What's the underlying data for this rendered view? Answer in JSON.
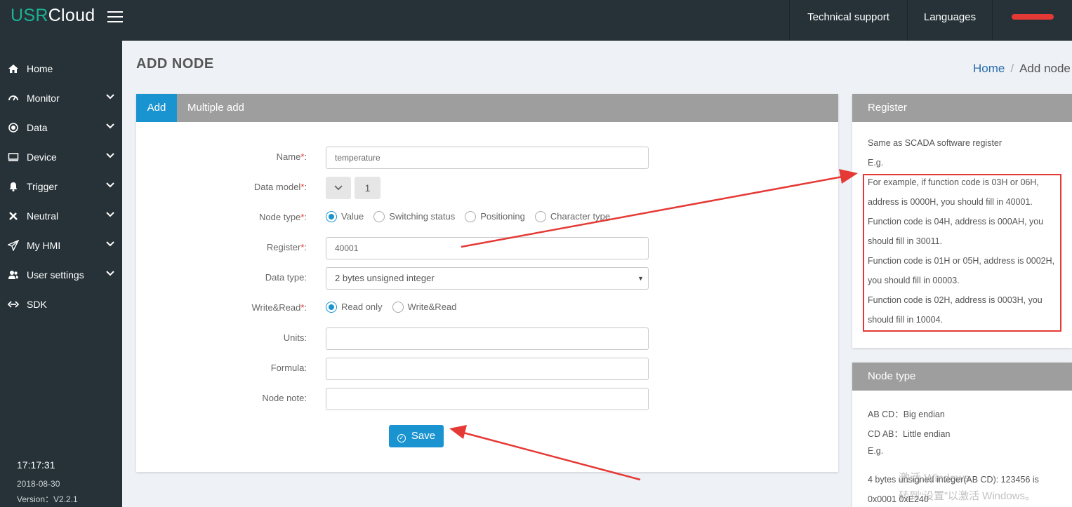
{
  "app": {
    "logo_usr": "USR",
    "logo_cloud": "Cloud"
  },
  "topbar": {
    "support": "Technical support",
    "languages": "Languages"
  },
  "sidebar": {
    "items": [
      {
        "label": "Home",
        "icon": "home-icon",
        "has_children": false
      },
      {
        "label": "Monitor",
        "icon": "gauge-icon",
        "has_children": true
      },
      {
        "label": "Data",
        "icon": "dot-circle-icon",
        "has_children": true
      },
      {
        "label": "Device",
        "icon": "monitor-icon",
        "has_children": true
      },
      {
        "label": "Trigger",
        "icon": "bell-icon",
        "has_children": true
      },
      {
        "label": "Neutral",
        "icon": "tools-icon",
        "has_children": true
      },
      {
        "label": "My HMI",
        "icon": "send-icon",
        "has_children": true
      },
      {
        "label": "User settings",
        "icon": "users-icon",
        "has_children": true
      },
      {
        "label": "SDK",
        "icon": "code-arrows-icon",
        "has_children": false
      }
    ],
    "time": "17:17:31",
    "date": "2018-08-30",
    "version": "Version：V2.2.1"
  },
  "page": {
    "title": "ADD NODE"
  },
  "breadcrumb": {
    "home": "Home",
    "separator": "/",
    "current": "Add node"
  },
  "tabs": {
    "add": "Add",
    "multiple_add": "Multiple add"
  },
  "form": {
    "name_label": "Name",
    "name_value": "temperature",
    "data_model_label": "Data model",
    "data_model_value": "1",
    "node_type_label": "Node type",
    "node_type_options": [
      "Value",
      "Switching status",
      "Positioning",
      "Character type"
    ],
    "node_type_selected": "Value",
    "register_label": "Register",
    "register_value": "40001",
    "data_type_label": "Data type",
    "data_type_value": "2 bytes unsigned integer",
    "write_read_label": "Write&Read",
    "write_read_options": [
      "Read only",
      "Write&Read"
    ],
    "write_read_selected": "Read only",
    "units_label": "Units",
    "formula_label": "Formula",
    "node_note_label": "Node note",
    "required_mark": "*",
    "colon": ":",
    "save": "Save"
  },
  "register_panel": {
    "title": "Register",
    "lines": [
      "Same as SCADA software register",
      "E.g.",
      "For example, if function code is 03H or 06H,",
      "address is 0000H, you should fill in 40001.",
      "Function code is 04H, address is 000AH, you",
      "should fill in 30011.",
      "Function code is 01H or 05H, address is 0002H,",
      "you should fill in 00003.",
      "Function code is 02H, address is 0003H, you",
      "should fill in 10004."
    ]
  },
  "node_type_panel": {
    "title": "Node type",
    "lines": [
      "AB CD：Big endian",
      "CD AB：Little endian",
      "E.g.",
      "4 bytes unsigned integer(AB CD): 123456 is",
      "0x0001 0xE240"
    ]
  },
  "watermark": {
    "line1": "激活 Windows",
    "line2": "转到“设置”以激活 Windows。"
  },
  "colors": {
    "topbar": "#263238",
    "accent": "#1a94d0",
    "annotation": "#e53935",
    "brand_green": "#1ab394"
  }
}
